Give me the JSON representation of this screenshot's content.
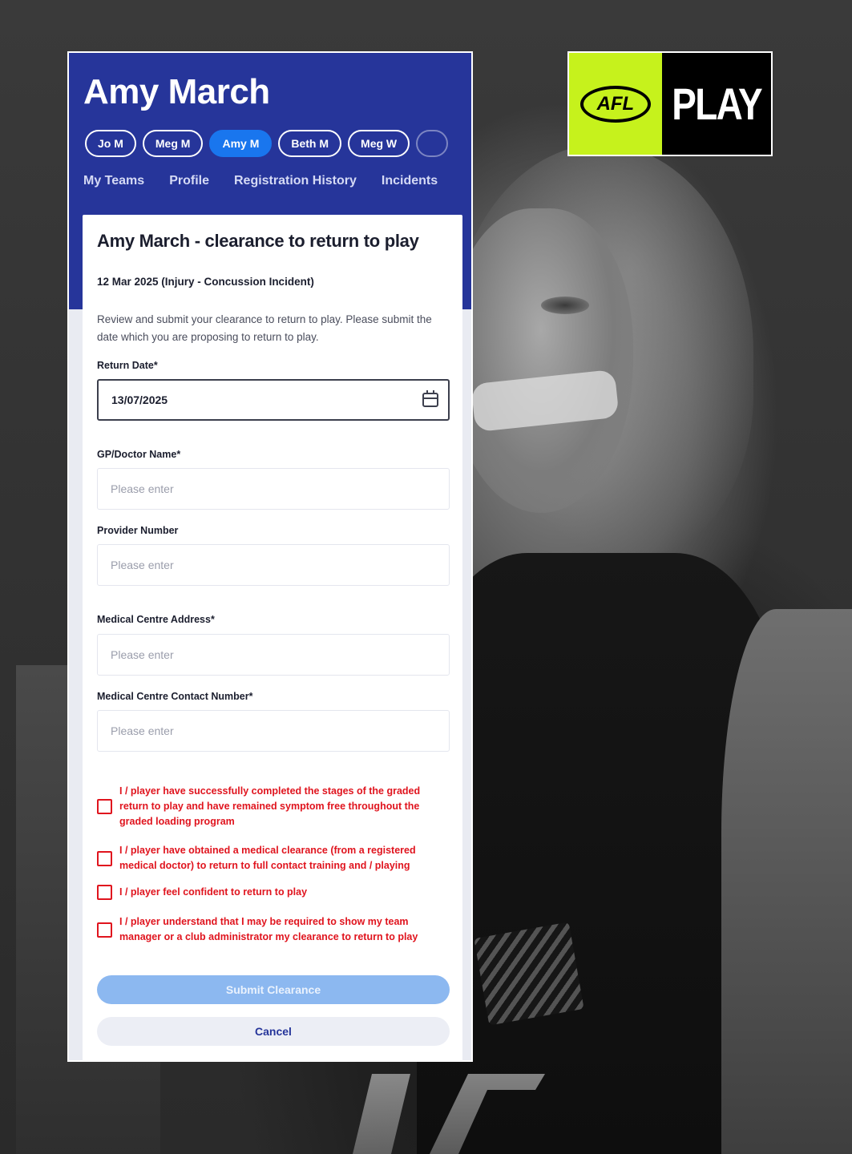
{
  "profile": {
    "name": "Amy March"
  },
  "chips": [
    "Jo M",
    "Meg M",
    "Amy M",
    "Beth M",
    "Meg W"
  ],
  "tabs": [
    "My Teams",
    "Profile",
    "Registration History",
    "Incidents"
  ],
  "form": {
    "title": "Amy March - clearance to return to play",
    "incident": "12 Mar 2025 (Injury - Concussion Incident)",
    "description": "Review and submit your clearance to return to play. Please submit the date which you are proposing to return to play.",
    "return_date_label": "Return Date*",
    "return_date_value": "13/07/2025",
    "doctor_label": "GP/Doctor Name*",
    "provider_label": "Provider Number",
    "address_label": "Medical Centre Address*",
    "contact_label": "Medical Centre Contact Number*",
    "placeholder": "Please enter",
    "checks": [
      "I / player have successfully completed the stages of the graded return to play and have remained symptom free throughout the graded loading program",
      "I / player have obtained a medical clearance (from a registered medical doctor) to return to full contact training and / playing",
      "I / player feel confident to return to play",
      "I / player understand that I may be required to show my team manager or a club administrator my clearance to return to play"
    ],
    "submit_label": "Submit Clearance",
    "cancel_label": "Cancel"
  },
  "logo": {
    "left": "AFL",
    "right": "PLAY"
  },
  "colors": {
    "header": "#26359a",
    "active_chip": "#1976ee",
    "error": "#e0141e",
    "logo_green": "#c6f21c"
  }
}
